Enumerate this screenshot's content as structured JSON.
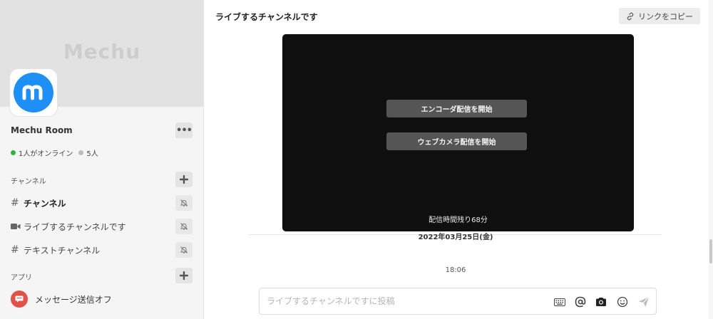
{
  "sidebar": {
    "banner_text": "Mechu",
    "room_name": "Mechu Room",
    "more_label": "•••",
    "presence": {
      "online": "1人がオンライン",
      "members": "5人"
    },
    "channels_section": "チャンネル",
    "channels": [
      {
        "icon": "#",
        "label": "チャンネル",
        "active": true
      },
      {
        "icon": "video-camera-icon",
        "label": "ライブするチャンネルです",
        "active": false
      },
      {
        "icon": "#",
        "label": "テキストチャンネル",
        "active": false
      }
    ],
    "apps_section": "アプリ",
    "app_item": "メッセージ送信オフ"
  },
  "main": {
    "title": "ライブするチャンネルです",
    "copy_link": "リンクをコピー",
    "video": {
      "encoder_button": "エンコーダ配信を開始",
      "webcam_button": "ウェブカメラ配信を開始",
      "remaining": "配信時間残り68分"
    },
    "date": "2022年03月25日(金)",
    "time": "18:06",
    "composer": {
      "placeholder": "ライブするチャンネルですに投稿"
    }
  },
  "colors": {
    "accent_blue": "#1e8ff5",
    "online_green": "#2fb146",
    "app_red": "#e0524a",
    "video_bg": "#0f0f10"
  }
}
